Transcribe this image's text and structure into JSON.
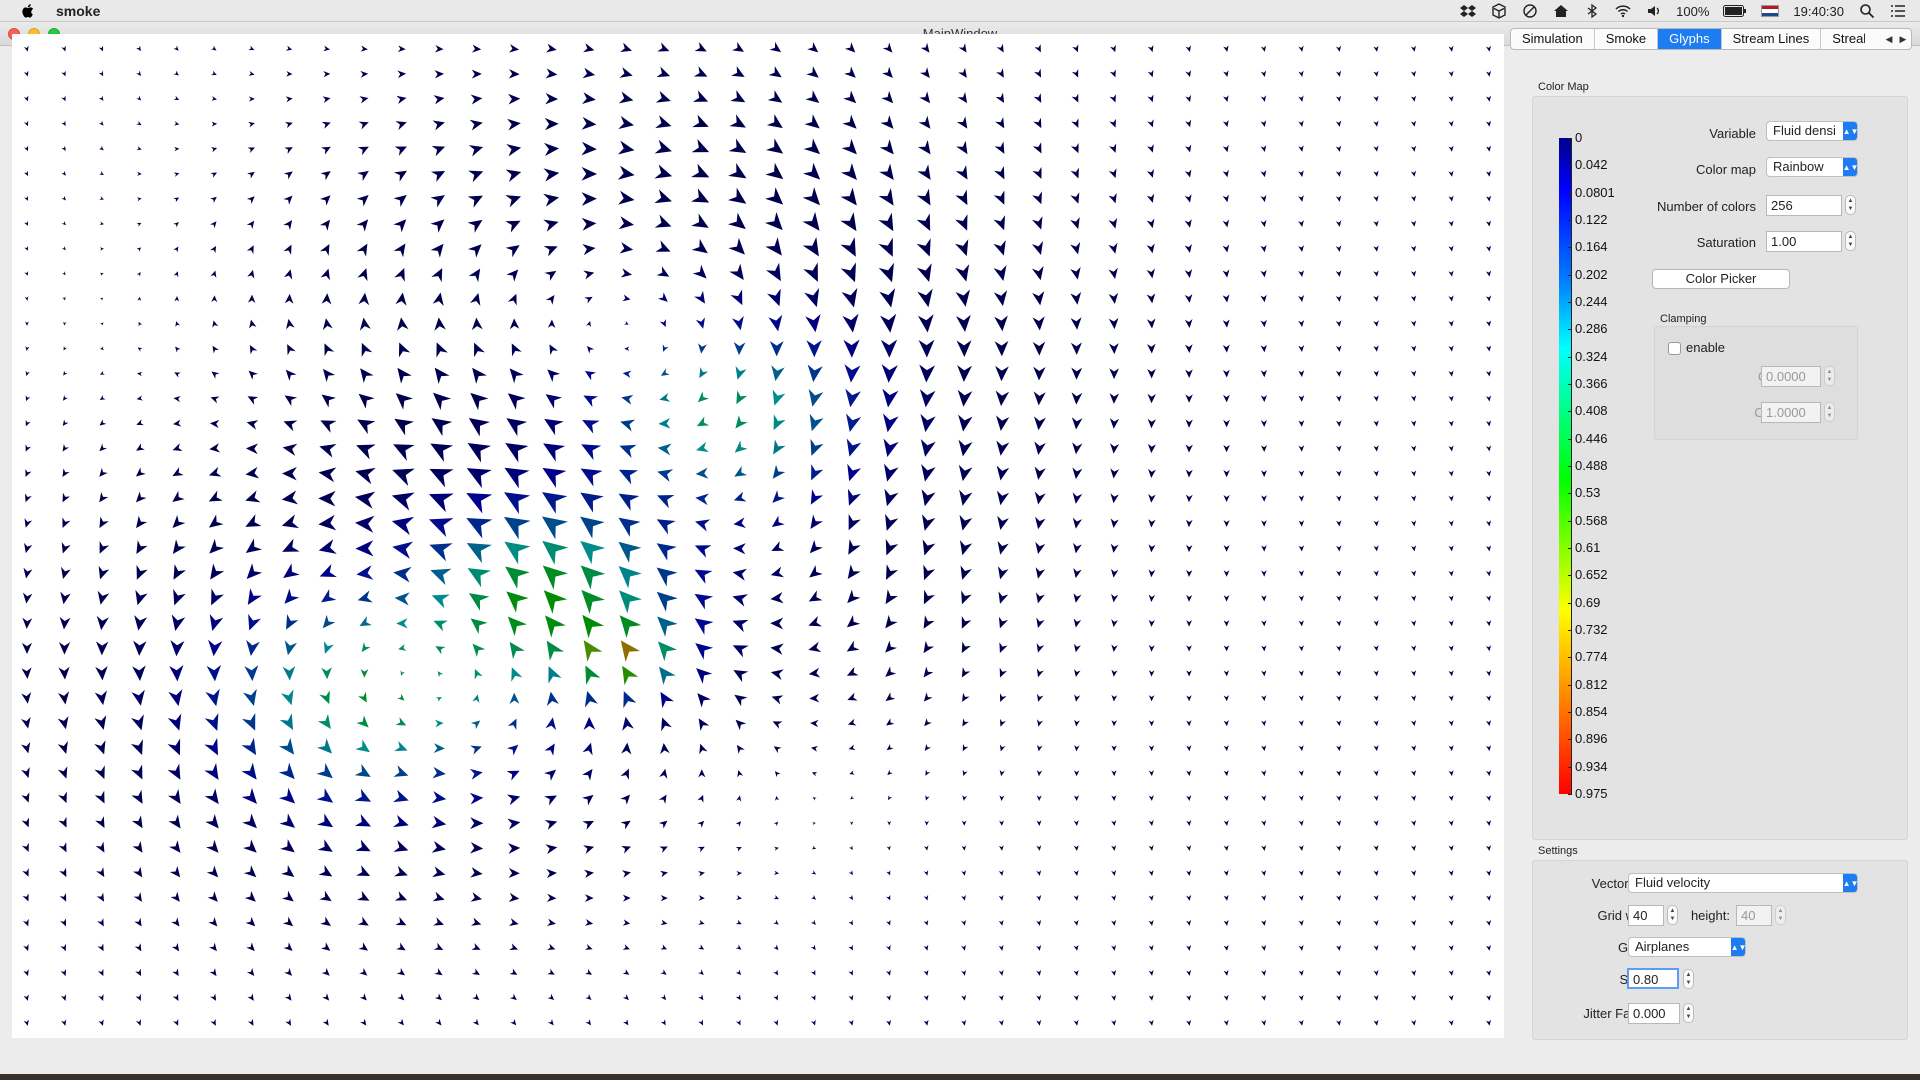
{
  "menubar": {
    "app_name": "smoke",
    "battery": "100%",
    "time": "19:40:30",
    "icons": [
      "dropbox-icon",
      "box-icon",
      "sync-icon",
      "home-icon",
      "bluetooth-icon",
      "wifi-icon",
      "volume-icon",
      "battery-icon",
      "flag-icon",
      "search-icon",
      "menu-list-icon"
    ]
  },
  "window": {
    "title": "MainWindow"
  },
  "tabs": [
    {
      "label": "Simulation",
      "active": false
    },
    {
      "label": "Smoke",
      "active": false
    },
    {
      "label": "Glyphs",
      "active": true
    },
    {
      "label": "Stream Lines",
      "active": false
    },
    {
      "label": "Streak",
      "active": false
    }
  ],
  "color_map": {
    "group_label": "Color Map",
    "variable_label": "Variable",
    "variable_value": "Fluid densi",
    "colormap_label": "Color map",
    "colormap_value": "Rainbow",
    "num_colors_label": "Number of colors",
    "num_colors_value": "256",
    "saturation_label": "Saturation",
    "saturation_value": "1.00",
    "color_picker_button": "Color Picker",
    "clamping_label": "Clamping",
    "enable_label": "enable",
    "enable_checked": false,
    "clamp_min_label": "Clamp min",
    "clamp_min_value": "0.0000",
    "clamp_max_label": "Clamp max",
    "clamp_max_value": "1.0000",
    "legend_ticks": [
      "0",
      "0.042",
      "0.0801",
      "0.122",
      "0.164",
      "0.202",
      "0.244",
      "0.286",
      "0.324",
      "0.366",
      "0.408",
      "0.446",
      "0.488",
      "0.53",
      "0.568",
      "0.61",
      "0.652",
      "0.69",
      "0.732",
      "0.774",
      "0.812",
      "0.854",
      "0.896",
      "0.934",
      "0.975"
    ]
  },
  "settings": {
    "group_label": "Settings",
    "vector_field_label": "Vector field",
    "vector_field_value": "Fluid velocity",
    "grid_width_label": "Grid width",
    "grid_width_value": "40",
    "height_label": "height:",
    "height_value": "40",
    "glyph_label": "Glyph",
    "glyph_value": "Airplanes",
    "scale_label": "Scale",
    "scale_value": "0.80",
    "jitter_label": "Jitter Factor",
    "jitter_value": "0.000"
  },
  "colors": {
    "accent": "#1d7cf2",
    "close": "#fc5f57",
    "minimize": "#fdbc2e",
    "maximize": "#28c840"
  }
}
